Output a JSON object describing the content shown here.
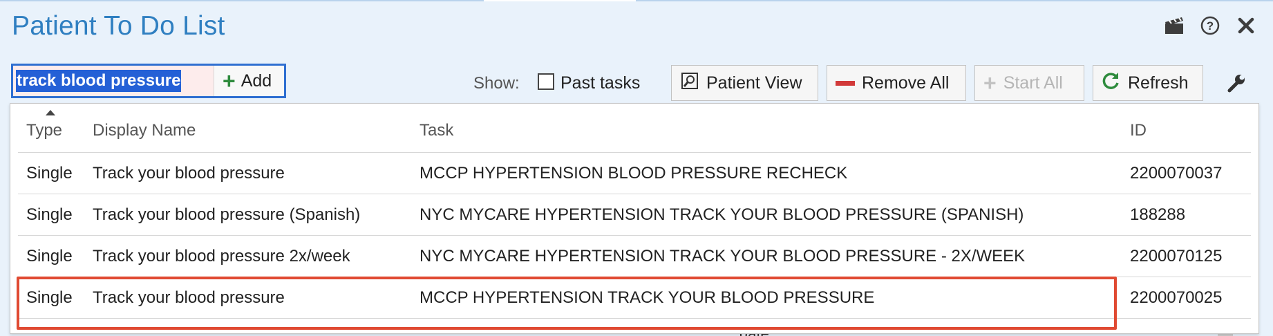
{
  "window": {
    "title": "Patient To Do List",
    "icons": [
      "clapperboard-icon",
      "help-icon",
      "close-icon"
    ]
  },
  "search": {
    "value": "track blood pressure",
    "add_label": "Add"
  },
  "toolbar": {
    "show_label": "Show:",
    "past_tasks_label": "Past tasks",
    "past_tasks_checked": false,
    "patient_view_label": "Patient View",
    "remove_all_label": "Remove All",
    "start_all_label": "Start All",
    "refresh_label": "Refresh"
  },
  "table": {
    "columns": [
      "Type",
      "Display Name",
      "Task",
      "ID"
    ],
    "rows": [
      {
        "type": "Single",
        "display_name": "Track your blood pressure",
        "task": "MCCP HYPERTENSION BLOOD PRESSURE RECHECK",
        "id": "2200070037"
      },
      {
        "type": "Single",
        "display_name": "Track your blood pressure (Spanish)",
        "task": "NYC MYCARE HYPERTENSION TRACK YOUR BLOOD PRESSURE (SPANISH)",
        "id": "188288"
      },
      {
        "type": "Single",
        "display_name": "Track your blood pressure 2x/week",
        "task": "NYC MYCARE HYPERTENSION TRACK YOUR BLOOD PRESSURE - 2X/WEEK",
        "id": "2200070125"
      },
      {
        "type": "Single",
        "display_name": "Track your blood pressure",
        "task": "MCCP HYPERTENSION TRACK YOUR BLOOD PRESSURE",
        "id": "2200070025"
      }
    ]
  },
  "background_partial_text": "date",
  "colors": {
    "title": "#2f7fc1",
    "selection": "#2460d6",
    "highlight_border": "#e04a32",
    "add_icon": "#2e8b3d",
    "remove_icon": "#d23a3a",
    "refresh_icon": "#2e8b3d"
  }
}
